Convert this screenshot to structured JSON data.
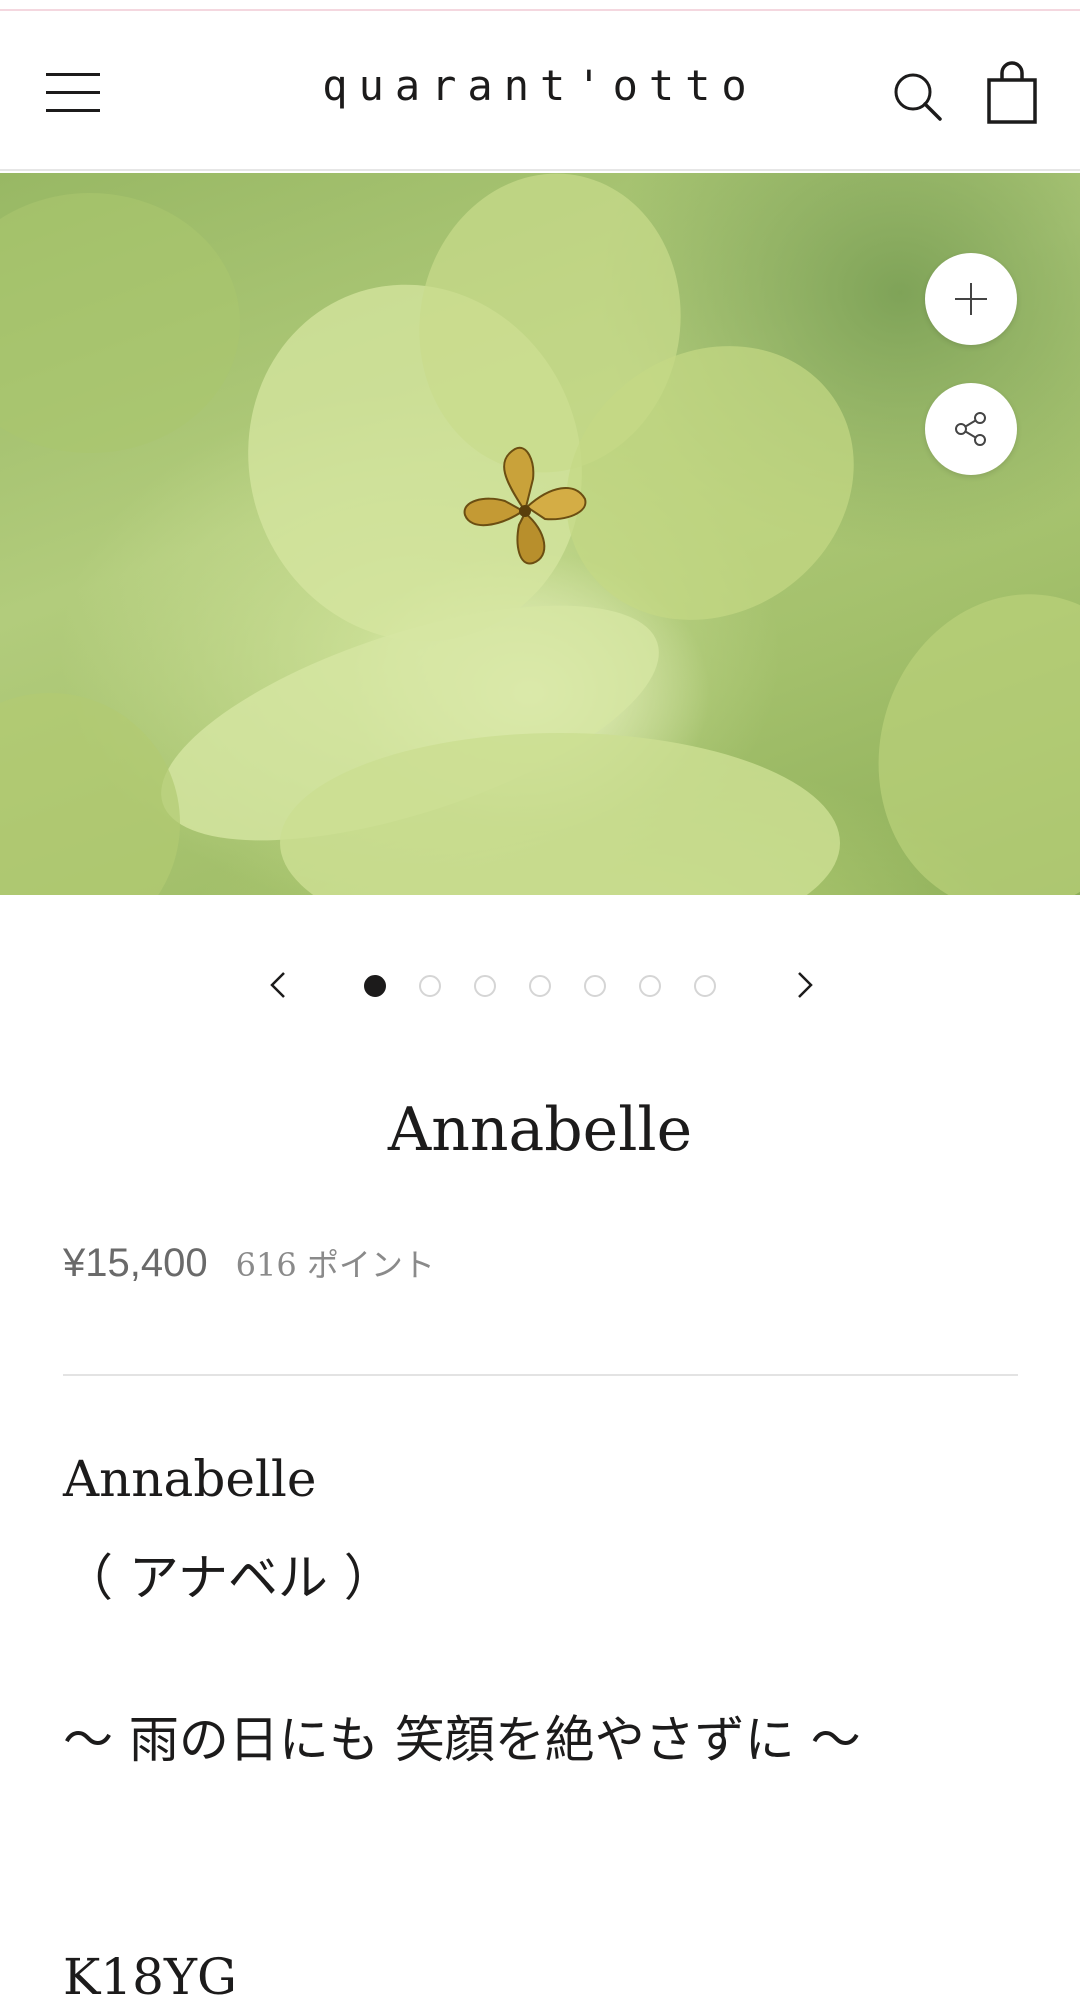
{
  "header": {
    "logo": "quarant'otto",
    "menu_icon": "hamburger-menu-icon",
    "search_icon": "search-icon",
    "cart_icon": "shopping-bag-icon"
  },
  "gallery": {
    "zoom_icon": "plus-icon",
    "share_icon": "share-icon",
    "prev_icon": "chevron-left-icon",
    "next_icon": "chevron-right-icon",
    "slide_count": 7,
    "active_slide": 1
  },
  "product": {
    "title": "Annabelle",
    "price": "¥15,400",
    "points": "616 ポイント",
    "description": {
      "name": "Annabelle",
      "kana": "（ アナベル ）",
      "tagline": "〜 雨の日にも 笑顔を絶やさずに 〜",
      "material": "K18YG"
    }
  },
  "colors": {
    "text": "#1c1b1b",
    "price": "#6a6a6a",
    "accent_line": "#f4d7df"
  }
}
